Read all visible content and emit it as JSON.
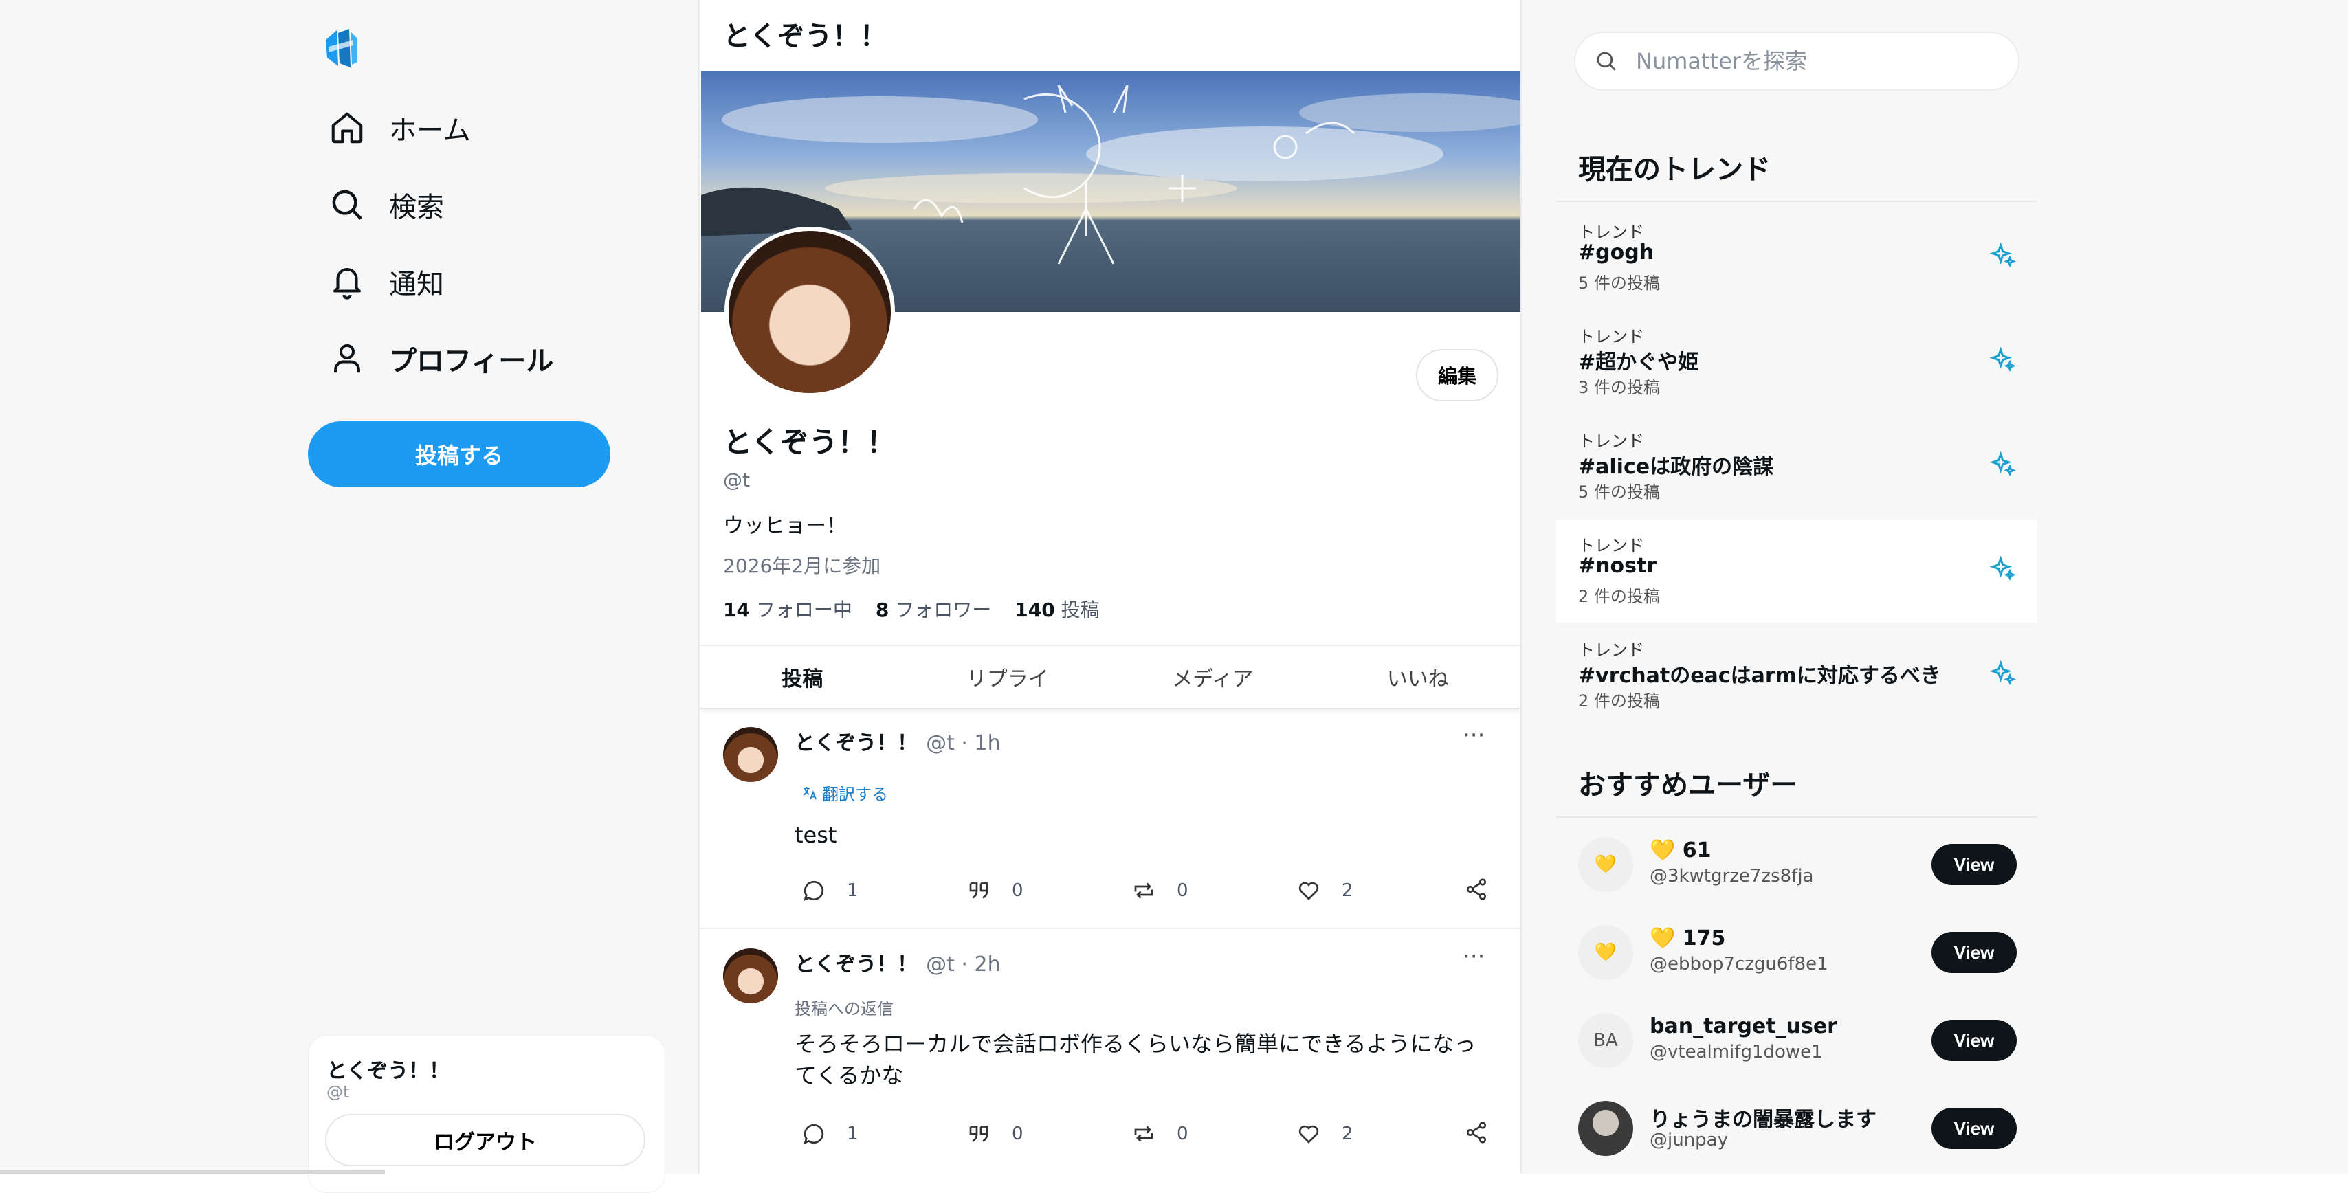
{
  "colors": {
    "accent": "#1d9bf0",
    "trend_icon": "#1ea0d0",
    "text": "#0f1419"
  },
  "nav": [
    {
      "label": "ホーム",
      "icon": "home-icon"
    },
    {
      "label": "検索",
      "icon": "search-icon"
    },
    {
      "label": "通知",
      "icon": "bell-icon"
    },
    {
      "label": "プロフィール",
      "icon": "user-icon"
    }
  ],
  "post_button": "投稿する",
  "account": {
    "name": "とくぞう！！",
    "handle": "@t",
    "logout": "ログアウト"
  },
  "header": {
    "title": "とくぞう！！"
  },
  "profile": {
    "edit": "編集",
    "name": "とくぞう！！",
    "handle": "@t",
    "bio": "ウッヒョー！",
    "joined": "2026年2月に参加",
    "following_count": "14",
    "following_label": "フォロー中",
    "followers_count": "8",
    "followers_label": "フォロワー",
    "posts_count": "140",
    "posts_label": "投稿"
  },
  "tabs": [
    "投稿",
    "リプライ",
    "メディア",
    "いいね"
  ],
  "posts": [
    {
      "author": "とくぞう！！",
      "meta": "@t · 1h",
      "translate": "翻訳する",
      "text": "test",
      "replies": "1",
      "quotes": "0",
      "reposts": "0",
      "likes": "2"
    },
    {
      "author": "とくぞう！！",
      "meta": "@t · 2h",
      "reply_note": "投稿への返信",
      "text": "そろそろローカルで会話ロボ作るくらいなら簡単にできるようになってくるかな",
      "replies": "1",
      "quotes": "0",
      "reposts": "0",
      "likes": "2"
    }
  ],
  "search": {
    "placeholder": "Numatterを探索"
  },
  "trends_title": "現在のトレンド",
  "trends": [
    {
      "kicker": "トレンド",
      "tag": "#gogh",
      "count": "5 件の投稿"
    },
    {
      "kicker": "トレンド",
      "tag": "#超かぐや姫",
      "count": "3 件の投稿"
    },
    {
      "kicker": "トレンド",
      "tag": "#aliceは政府の陰謀",
      "count": "5 件の投稿"
    },
    {
      "kicker": "トレンド",
      "tag": "#nostr",
      "count": "2 件の投稿"
    },
    {
      "kicker": "トレンド",
      "tag": "#vrchatのeacはarmに対応するべき",
      "count": "2 件の投稿"
    }
  ],
  "recommended_title": "おすすめユーザー",
  "recommended": [
    {
      "avatar": "💛",
      "name": "💛 61",
      "handle": "@3kwtgrze7zs8fja",
      "button": "View"
    },
    {
      "avatar": "💛",
      "name": "💛 175",
      "handle": "@ebbop7czgu6f8e1",
      "button": "View"
    },
    {
      "avatar": "BA",
      "name": "ban_target_user",
      "handle": "@vtealmifg1dowe1",
      "button": "View"
    },
    {
      "avatar": "",
      "name": "りょうまの闇暴露します",
      "handle": "@junpay",
      "button": "View"
    }
  ]
}
